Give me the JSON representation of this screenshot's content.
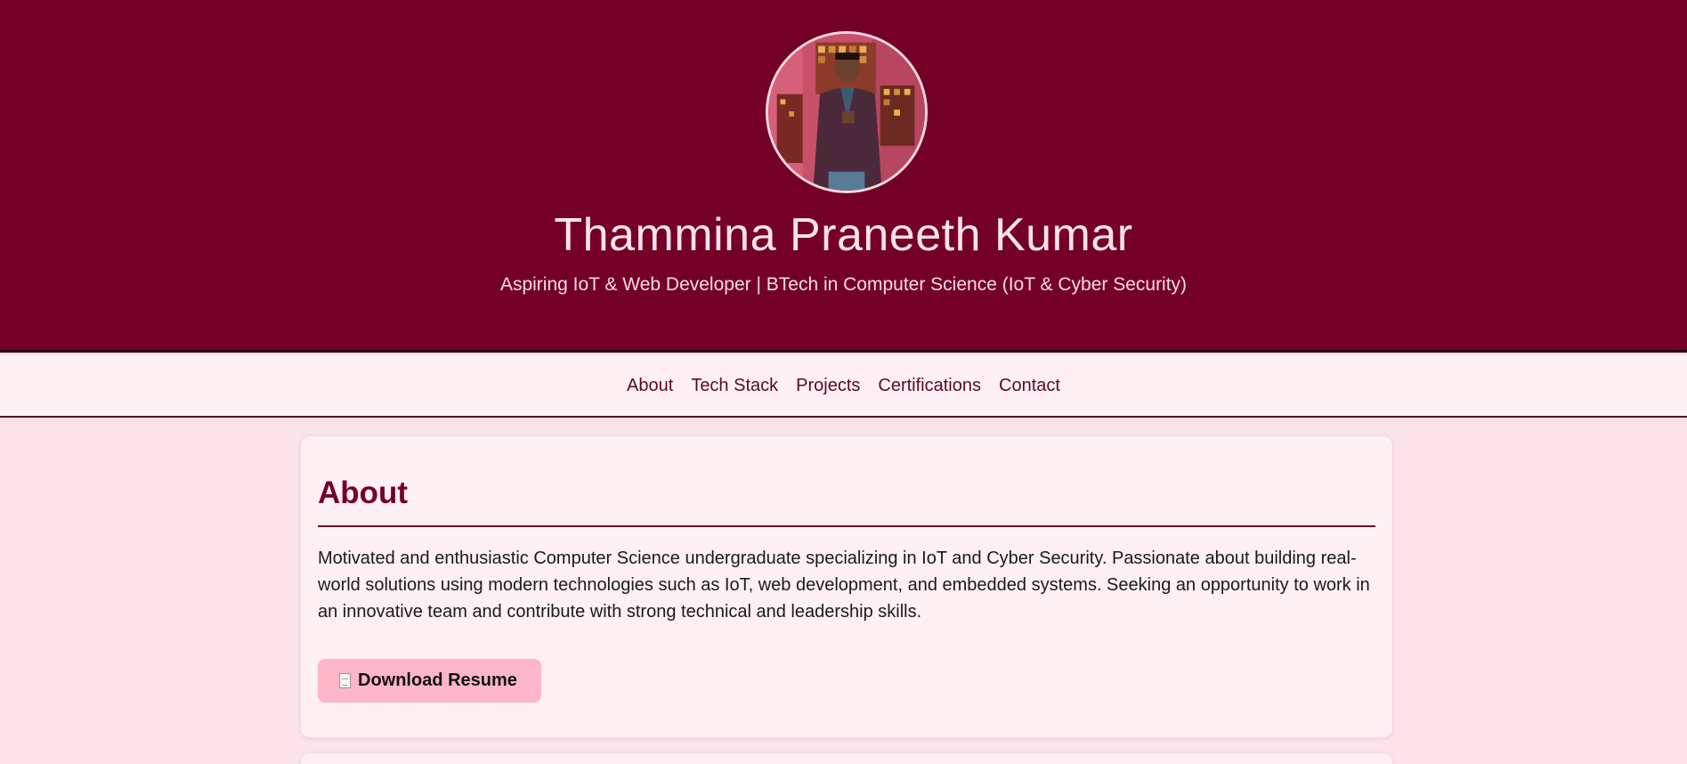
{
  "header": {
    "name": "Thammina Praneeth Kumar",
    "tagline": "Aspiring IoT & Web Developer | BTech in Computer Science (IoT & Cyber Security)"
  },
  "nav": {
    "items": [
      "About",
      "Tech Stack",
      "Projects",
      "Certifications",
      "Contact"
    ]
  },
  "about": {
    "heading": "About",
    "body": "Motivated and enthusiastic Computer Science undergraduate specializing in IoT and Cyber Security. Passionate about building real-world solutions using modern technologies such as IoT, web development, and embedded systems. Seeking an opportunity to work in an innovative team and contribute with strong technical and leadership skills.",
    "button_label": "Download Resume",
    "button_icon": "document-icon"
  },
  "colors": {
    "header_bg": "#750027",
    "page_bg": "#fbe3ea",
    "card_bg": "#fff0f4",
    "button_bg": "#ffb6c8",
    "accent": "#750027"
  }
}
